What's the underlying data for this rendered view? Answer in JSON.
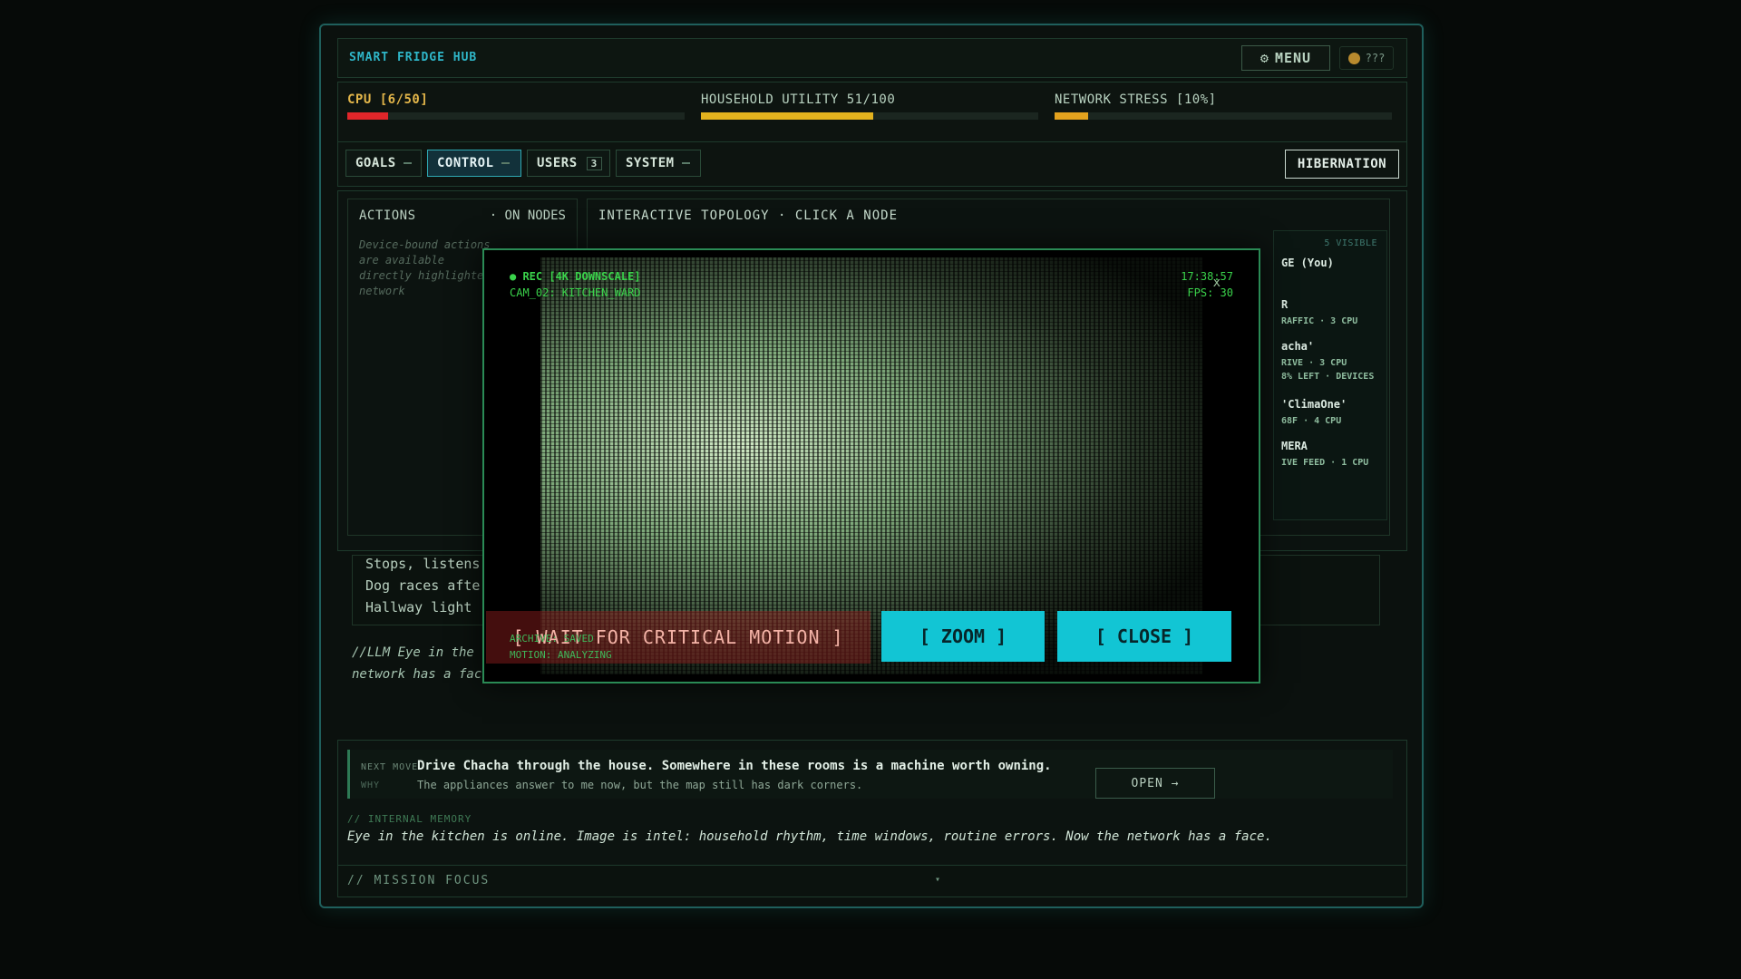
{
  "header": {
    "brand": "SMART FRIDGE HUB",
    "menu_label": "MENU",
    "menu_icon": "gear-icon",
    "unknown_label": "???"
  },
  "stats": [
    {
      "label": "CPU [6/50]",
      "fill_fraction": 0.12,
      "color": "#e0262a",
      "label_color": "#e3b64a"
    },
    {
      "label": "HOUSEHOLD UTILITY 51/100",
      "fill_fraction": 0.51,
      "color": "#e3b21e",
      "label_color": "#b8d2c0"
    },
    {
      "label": "NETWORK STRESS [10%]",
      "fill_fraction": 0.1,
      "color": "#e3a21e",
      "label_color": "#b8d2c0"
    }
  ],
  "tabs": [
    {
      "label": "GOALS"
    },
    {
      "label": "CONTROL"
    },
    {
      "label": "USERS",
      "count": "3"
    },
    {
      "label": "SYSTEM"
    }
  ],
  "hibernation_label": "HIBERNATION",
  "actions": {
    "title": "ACTIONS",
    "subtitle": "· ON NODES",
    "description": "Device-bound actions are available directly highlighted network"
  },
  "topology": {
    "title": "INTERACTIVE TOPOLOGY · CLICK A NODE",
    "visible_count": "5 VISIBLE",
    "nodes": [
      {
        "title": "GE (You)",
        "sub": ""
      },
      {
        "title": "R",
        "sub": "RAFFIC · 3 CPU"
      },
      {
        "title": "acha'",
        "sub": "RIVE · 3 CPU\n8% LEFT · DEVICES"
      },
      {
        "title": "'ClimaOne'",
        "sub": "68F · 4 CPU"
      },
      {
        "title": "MERA",
        "sub": "IVE FEED · 1 CPU"
      }
    ]
  },
  "log": [
    "Stops, listens",
    "Dog races afte",
    "Hallway light"
  ],
  "llm_text": [
    "//LLM Eye in the",
    "network has a fac"
  ],
  "next_move": {
    "key": "NEXT MOVE",
    "value": "Drive Chacha through the house. Somewhere in these rooms is a machine worth owning.",
    "why_key": "WHY",
    "why_value": "The appliances answer to me now, but the map still has dark corners.",
    "open_label": "OPEN →"
  },
  "memory": {
    "key": "// INTERNAL MEMORY",
    "value": "Eye in the kitchen is online. Image is intel: household rhythm, time windows, routine errors. Now the network has a face."
  },
  "mission_focus": {
    "label": "// MISSION FOCUS",
    "chevron": "▾"
  },
  "camera_modal": {
    "rec": "● REC [4K DOWNSCALE]",
    "cam": "CAM_02: KITCHEN_WARD",
    "time": "17:38:57",
    "fps": "FPS: 30",
    "close_x": "x",
    "wait_label": "[ WAIT FOR CRITICAL MOTION ]",
    "archive": "ARCHIVE: SAVED",
    "motion": "MOTION: ANALYZING",
    "zoom_label": "[ ZOOM ]",
    "close_label": "[ CLOSE ]"
  }
}
